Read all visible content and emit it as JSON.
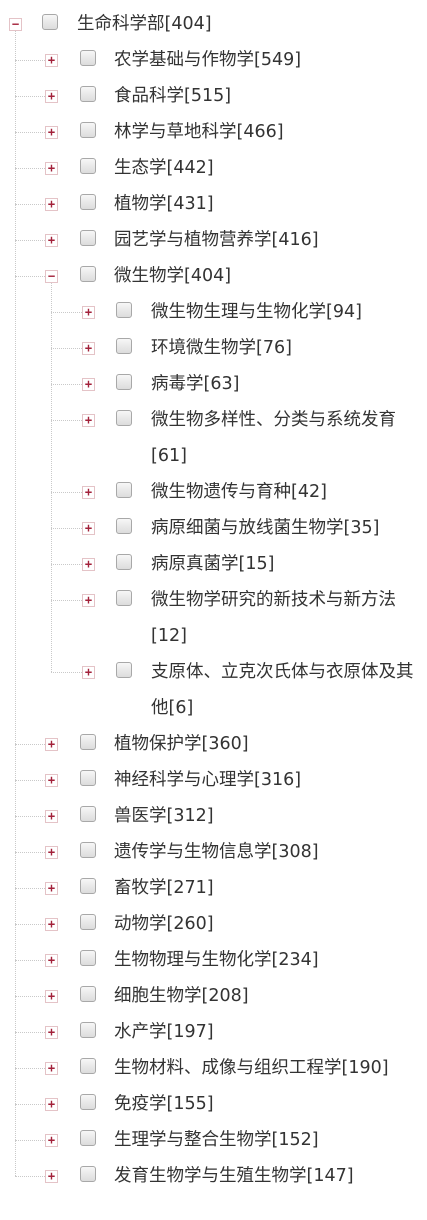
{
  "tree": {
    "root": {
      "label": "生命科学部[404]",
      "expanded": true,
      "toggle_symbol": "−",
      "children": [
        {
          "label": "农学基础与作物学[549]",
          "toggle_symbol": "+"
        },
        {
          "label": "食品科学[515]",
          "toggle_symbol": "+"
        },
        {
          "label": "林学与草地科学[466]",
          "toggle_symbol": "+"
        },
        {
          "label": "生态学[442]",
          "toggle_symbol": "+"
        },
        {
          "label": "植物学[431]",
          "toggle_symbol": "+"
        },
        {
          "label": "园艺学与植物营养学[416]",
          "toggle_symbol": "+"
        },
        {
          "label": "微生物学[404]",
          "toggle_symbol": "−",
          "expanded": true,
          "children": [
            {
              "label": "微生物生理与生物化学[94]",
              "toggle_symbol": "+"
            },
            {
              "label": "环境微生物学[76]",
              "toggle_symbol": "+"
            },
            {
              "label": "病毒学[63]",
              "toggle_symbol": "+"
            },
            {
              "label": "微生物多样性、分类与系统发育[61]",
              "toggle_symbol": "+"
            },
            {
              "label": "微生物遗传与育种[42]",
              "toggle_symbol": "+"
            },
            {
              "label": "病原细菌与放线菌生物学[35]",
              "toggle_symbol": "+"
            },
            {
              "label": "病原真菌学[15]",
              "toggle_symbol": "+"
            },
            {
              "label": "微生物学研究的新技术与新方法[12]",
              "toggle_symbol": "+"
            },
            {
              "label": "支原体、立克次氏体与衣原体及其他[6]",
              "toggle_symbol": "+"
            }
          ]
        },
        {
          "label": "植物保护学[360]",
          "toggle_symbol": "+"
        },
        {
          "label": "神经科学与心理学[316]",
          "toggle_symbol": "+"
        },
        {
          "label": "兽医学[312]",
          "toggle_symbol": "+"
        },
        {
          "label": "遗传学与生物信息学[308]",
          "toggle_symbol": "+"
        },
        {
          "label": "畜牧学[271]",
          "toggle_symbol": "+"
        },
        {
          "label": "动物学[260]",
          "toggle_symbol": "+"
        },
        {
          "label": "生物物理与生物化学[234]",
          "toggle_symbol": "+"
        },
        {
          "label": "细胞生物学[208]",
          "toggle_symbol": "+"
        },
        {
          "label": "水产学[197]",
          "toggle_symbol": "+"
        },
        {
          "label": "生物材料、成像与组织工程学[190]",
          "toggle_symbol": "+"
        },
        {
          "label": "免疫学[155]",
          "toggle_symbol": "+"
        },
        {
          "label": "生理学与整合生物学[152]",
          "toggle_symbol": "+"
        },
        {
          "label": "发育生物学与生殖生物学[147]",
          "toggle_symbol": "+"
        }
      ]
    }
  }
}
